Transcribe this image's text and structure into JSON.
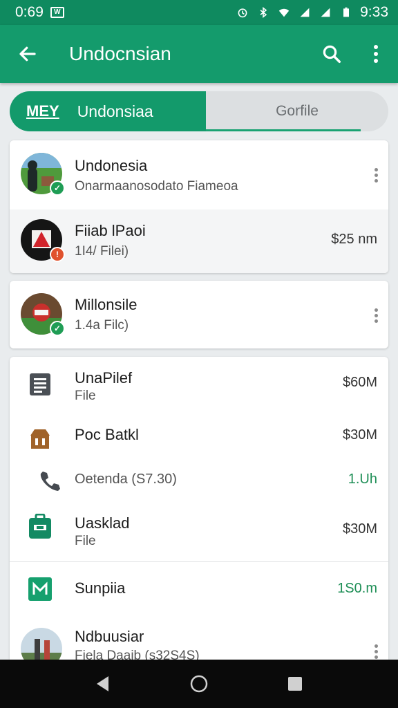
{
  "status": {
    "left_time": "0:69",
    "right_time": "9:33"
  },
  "appbar": {
    "title": "Undocnsian"
  },
  "tabs": {
    "active_prefix": "MEY",
    "active_label": "Undonsiaa",
    "inactive_label": "Gorfile"
  },
  "card1": [
    {
      "title": "Undonesia",
      "subtitle": "Onarmaanosodato Fiameoa",
      "value": "",
      "badge": "check",
      "badge_color": "#1f9d55"
    },
    {
      "title": "Fiiab lPaoi",
      "subtitle": "1I4/ Filei)",
      "value": "$25 nm",
      "badge": "alert",
      "badge_color": "#e0522e"
    }
  ],
  "card2": [
    {
      "title": "Millonsile",
      "subtitle": "1.4a Filc)",
      "value": "",
      "badge": "check",
      "badge_color": "#1f9d55"
    }
  ],
  "card3": [
    {
      "title": "UnaPilef",
      "subtitle": "File",
      "value": "$60M",
      "icon": "document-icon"
    },
    {
      "title": "Poc Batkl",
      "subtitle": "",
      "value": "$30M",
      "icon": "store-icon"
    },
    {
      "title": "Oetenda (S7.30)",
      "subtitle": "",
      "value": "1.Uh",
      "icon": "phone-icon"
    },
    {
      "title": "Uasklad",
      "subtitle": "File",
      "value": "$30M",
      "icon": "briefcase-icon"
    },
    {
      "title": "Sunpiia",
      "subtitle": "",
      "value": "1S0.m",
      "icon": "mail-icon"
    },
    {
      "title": "Ndbuusiar",
      "subtitle": "Fiela Daaib (s32S4S)",
      "value": ""
    }
  ],
  "colors": {
    "primary": "#149b6c",
    "status": "#0f8a5f",
    "green_value": "#1f8f57"
  }
}
